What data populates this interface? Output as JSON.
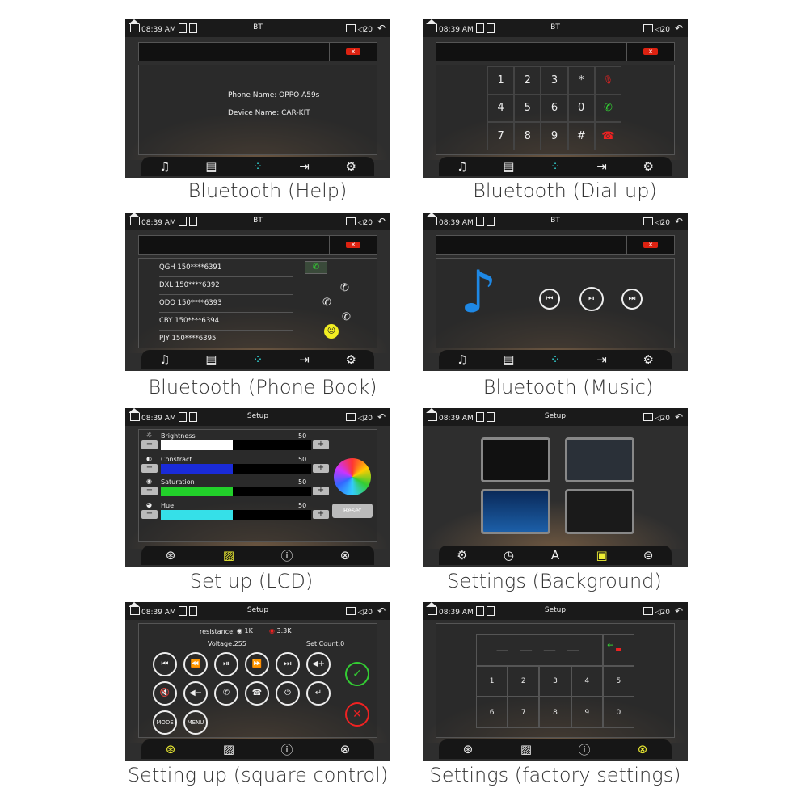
{
  "status": {
    "time": "08:39 AM",
    "volume": "20"
  },
  "titles": {
    "bt": "BT",
    "setup": "Setup"
  },
  "captions": {
    "help": "Bluetooth (Help)",
    "dial": "Bluetooth (Dial-up)",
    "book": "Bluetooth (Phone Book)",
    "music": "Bluetooth (Music)",
    "lcd": "Set up (LCD)",
    "bg": "Settings (Background)",
    "square": "Setting up (square control)",
    "factory": "Settings (factory settings)"
  },
  "help": {
    "phone_name": "Phone Name: OPPO A59s",
    "device_name": "Device Name: CAR-KIT"
  },
  "dialpad": [
    "1",
    "2",
    "3",
    "*",
    "",
    "4",
    "5",
    "6",
    "0",
    "",
    "7",
    "8",
    "9",
    "#",
    ""
  ],
  "phonebook": [
    "QGH 150****6391",
    "DXL 150****6392",
    "QDQ 150****6393",
    "CBY 150****6394",
    "PJY 150****6395"
  ],
  "lcd": {
    "sliders": [
      {
        "label": "Brightness",
        "value": "50",
        "color": "#ffffff"
      },
      {
        "label": "Constract",
        "value": "50",
        "color": "#1a2bd8"
      },
      {
        "label": "Saturation",
        "value": "50",
        "color": "#22d02a"
      },
      {
        "label": "Hue",
        "value": "50",
        "color": "#35e0e8"
      }
    ],
    "reset": "Reset"
  },
  "square": {
    "resistance": "resistance:",
    "r1": "1K",
    "r2": "3.3K",
    "voltage": "Voltage:255",
    "setcount": "Set Count:0",
    "mode": "MODE",
    "menu": "MENU"
  },
  "factory_pad": [
    "1",
    "2",
    "3",
    "4",
    "5",
    "6",
    "7",
    "8",
    "9",
    "0"
  ]
}
